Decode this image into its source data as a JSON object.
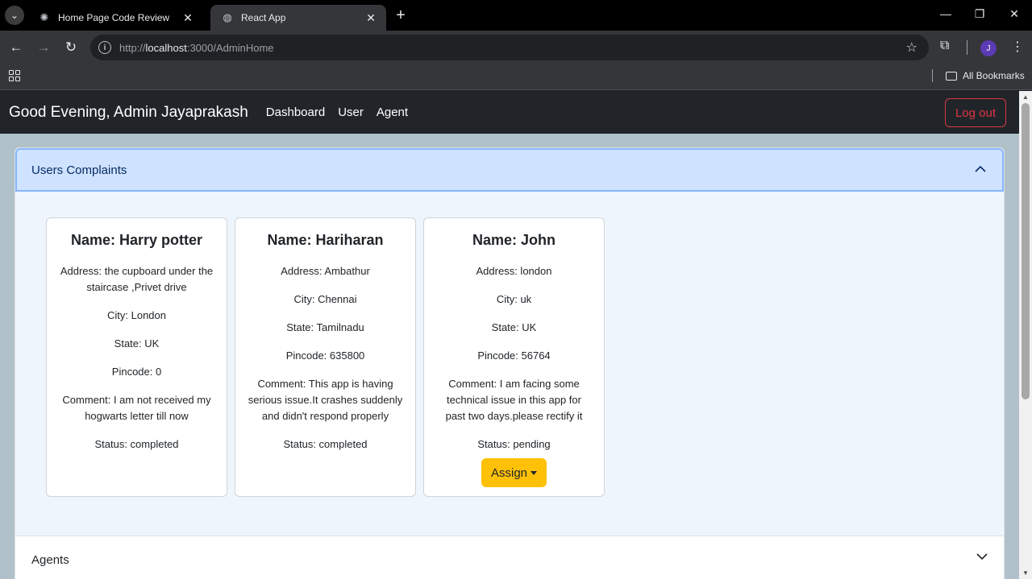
{
  "browser": {
    "tabs": [
      {
        "title": "Home Page Code Review",
        "icon": "openai-icon",
        "active": false
      },
      {
        "title": "React App",
        "icon": "globe-icon",
        "active": true
      }
    ],
    "url_prefix": "http://",
    "url_host": "localhost",
    "url_rest": ":3000/AdminHome",
    "avatar_letter": "J",
    "bookmarks_label": "All Bookmarks"
  },
  "navbar": {
    "brand": "Good Evening, Admin Jayaprakash",
    "links": [
      "Dashboard",
      "User",
      "Agent"
    ],
    "logout_label": "Log out"
  },
  "complaints_section": {
    "title": "Users Complaints",
    "expanded": true,
    "cards": [
      {
        "name": "Name: Harry potter",
        "address": "Address: the cupboard under the staircase ,Privet drive",
        "city": "City: London",
        "state": "State: UK",
        "pincode": "Pincode: 0",
        "comment": "Comment: I am not received my hogwarts letter till now",
        "status": "Status: completed"
      },
      {
        "name": "Name: Hariharan",
        "address": "Address: Ambathur",
        "city": "City: Chennai",
        "state": "State: Tamilnadu",
        "pincode": "Pincode: 635800",
        "comment": "Comment: This app is having serious issue.It crashes suddenly and didn't respond properly",
        "status": "Status: completed"
      },
      {
        "name": "Name: John",
        "address": "Address: london",
        "city": "City: uk",
        "state": "State: UK",
        "pincode": "Pincode: 56764",
        "comment": "Comment: I am facing some technical issue in this app for past two days.please rectify it",
        "status": "Status: pending",
        "action_label": "Assign"
      }
    ]
  },
  "agents_section": {
    "title": "Agents",
    "expanded": false
  },
  "colors": {
    "navbar_bg": "#212529",
    "accordion_active_bg": "#cfe2ff",
    "assign_btn": "#ffc107",
    "logout": "#dc3545",
    "page_bg": "#b1c1c9"
  }
}
